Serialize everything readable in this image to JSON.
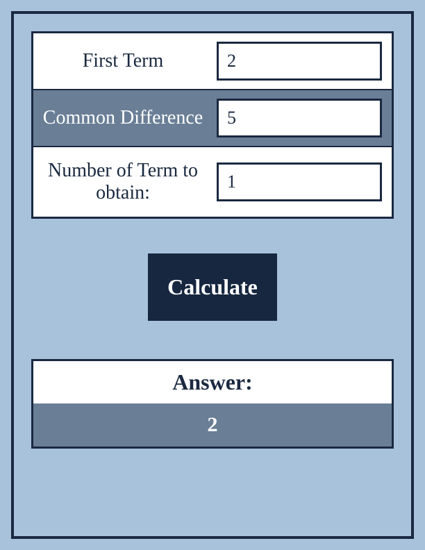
{
  "form": {
    "rows": [
      {
        "label": "First Term",
        "value": "2"
      },
      {
        "label": "Common Difference",
        "value": "5"
      },
      {
        "label": "Number of Term to obtain:",
        "value": "1"
      }
    ],
    "calculate_label": "Calculate"
  },
  "answer": {
    "label": "Answer:",
    "value": "2"
  },
  "colors": {
    "frame_border": "#1a2940",
    "background": "#a8c2dc",
    "row_dark": "#6a7f96",
    "button_bg": "#17273f"
  }
}
